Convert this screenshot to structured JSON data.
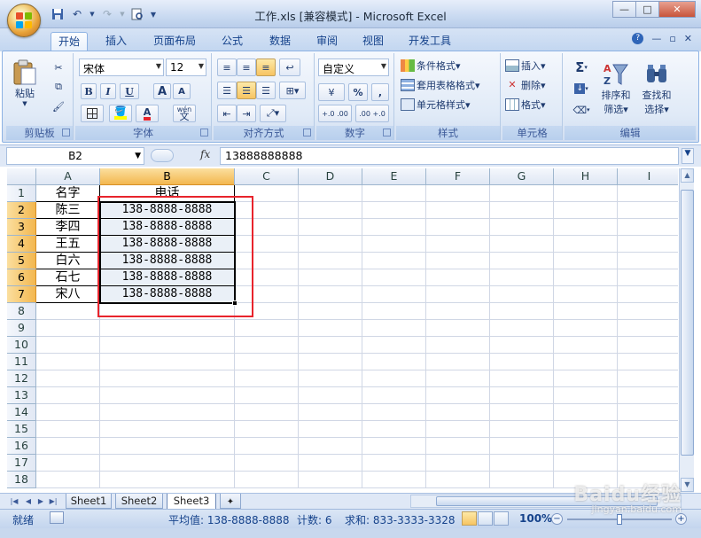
{
  "window": {
    "title": "工作.xls  [兼容模式] - Microsoft Excel",
    "controls": [
      "—",
      "□",
      "✕"
    ]
  },
  "tabs": [
    {
      "label": "开始",
      "active": true
    },
    {
      "label": "插入",
      "active": false
    },
    {
      "label": "页面布局",
      "active": false
    },
    {
      "label": "公式",
      "active": false
    },
    {
      "label": "数据",
      "active": false
    },
    {
      "label": "审阅",
      "active": false
    },
    {
      "label": "视图",
      "active": false
    },
    {
      "label": "开发工具",
      "active": false
    }
  ],
  "ribbon": {
    "clipboard": {
      "paste": "粘贴",
      "group": "剪贴板"
    },
    "font": {
      "name": "宋体",
      "size": "12",
      "group": "字体",
      "bold": "B",
      "italic": "I",
      "underline": "U",
      "grow": "A",
      "shrink": "A",
      "phonetic": "wén"
    },
    "alignment": {
      "group": "对齐方式"
    },
    "number": {
      "format": "自定义",
      "group": "数字",
      "currency": "¥",
      "percent": "%",
      "comma": ",",
      "inc_decimal": "+.0 .00",
      "dec_decimal": ".00 +.0"
    },
    "styles": {
      "conditional": "条件格式",
      "table": "套用表格格式",
      "cell": "单元格样式",
      "group": "样式"
    },
    "cells": {
      "insert": "插入",
      "delete": "删除",
      "format": "格式",
      "group": "单元格"
    },
    "editing": {
      "sum": "Σ",
      "sort": "排序和",
      "sort2": "筛选",
      "find": "查找和",
      "find2": "选择",
      "group": "编辑"
    }
  },
  "formula_bar": {
    "name_box": "B2",
    "fx": "fx",
    "value": "13888888888"
  },
  "columns": [
    "A",
    "B",
    "C",
    "D",
    "E",
    "F",
    "G",
    "H",
    "I"
  ],
  "rows": [
    "1",
    "2",
    "3",
    "4",
    "5",
    "6",
    "7",
    "8",
    "9",
    "10",
    "11",
    "12",
    "13",
    "14",
    "15",
    "16",
    "17",
    "18"
  ],
  "cells": {
    "A1": "名字",
    "B1": "电话",
    "A2": "陈三",
    "B2": "138-8888-8888",
    "A3": "李四",
    "B3": "138-8888-8888",
    "A4": "王五",
    "B4": "138-8888-8888",
    "A5": "白六",
    "B5": "138-8888-8888",
    "A6": "石七",
    "B6": "138-8888-8888",
    "A7": "宋八",
    "B7": "138-8888-8888"
  },
  "sheets": [
    {
      "label": "Sheet1",
      "active": false
    },
    {
      "label": "Sheet2",
      "active": false
    },
    {
      "label": "Sheet3",
      "active": true
    }
  ],
  "status": {
    "ready": "就绪",
    "average": "平均值: 138-8888-8888",
    "count": "计数: 6",
    "sum": "求和: 833-3333-3328",
    "zoom": "100%"
  },
  "watermark": {
    "brand": "Baidu经验",
    "url": "jingyan.baidu.com"
  },
  "colors": {
    "accent": "#15428b",
    "highlight": "#e8242c",
    "selected_header": "#f3b74f"
  }
}
